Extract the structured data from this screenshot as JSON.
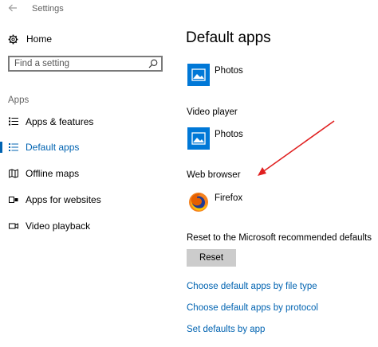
{
  "window": {
    "title": "Settings"
  },
  "sidebar": {
    "home_label": "Home",
    "search": {
      "placeholder": "Find a setting"
    },
    "section_label": "Apps",
    "items": [
      {
        "label": "Apps & features",
        "icon": "list-icon",
        "active": false
      },
      {
        "label": "Default apps",
        "icon": "default-apps-icon",
        "active": true
      },
      {
        "label": "Offline maps",
        "icon": "map-icon",
        "active": false
      },
      {
        "label": "Apps for websites",
        "icon": "web-apps-icon",
        "active": false
      },
      {
        "label": "Video playback",
        "icon": "video-icon",
        "active": false
      }
    ]
  },
  "main": {
    "title": "Default apps",
    "photo_viewer": {
      "app": "Photos",
      "icon": "photos-icon"
    },
    "video_player": {
      "label": "Video player",
      "app": "Photos",
      "icon": "photos-icon"
    },
    "web_browser": {
      "label": "Web browser",
      "app": "Firefox",
      "icon": "firefox-icon"
    },
    "reset": {
      "label": "Reset to the Microsoft recommended defaults",
      "button": "Reset"
    },
    "links": [
      "Choose default apps by file type",
      "Choose default apps by protocol",
      "Set defaults by app"
    ]
  },
  "colors": {
    "accent": "#0063b1",
    "tile_blue": "#0078d7",
    "annotation_arrow": "#e02020",
    "button_gray": "#cccccc"
  }
}
